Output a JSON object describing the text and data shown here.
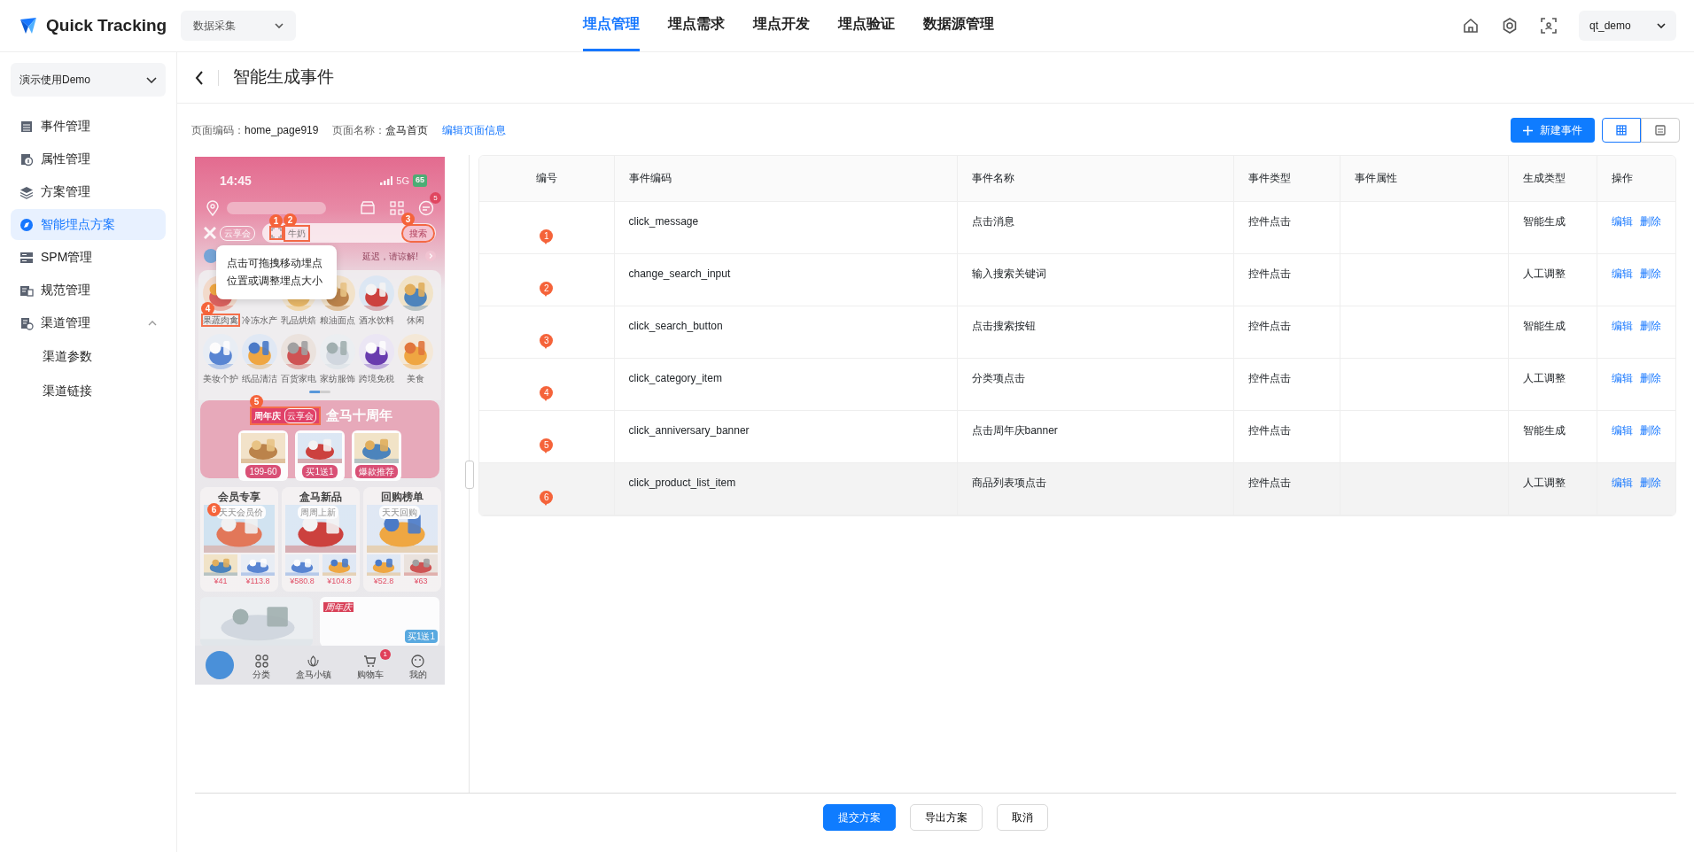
{
  "header": {
    "logo": "Quick Tracking",
    "workspace": "数据采集",
    "user": "qt_demo",
    "nav": [
      {
        "label": "埋点管理",
        "selected": true
      },
      {
        "label": "埋点需求",
        "selected": false
      },
      {
        "label": "埋点开发",
        "selected": false
      },
      {
        "label": "埋点验证",
        "selected": false
      },
      {
        "label": "数据源管理",
        "selected": false
      }
    ]
  },
  "sidebar": {
    "project": "演示使用Demo",
    "items": [
      {
        "label": "事件管理",
        "selected": false
      },
      {
        "label": "属性管理",
        "selected": false
      },
      {
        "label": "方案管理",
        "selected": false
      },
      {
        "label": "智能埋点方案",
        "selected": true
      },
      {
        "label": "SPM管理",
        "selected": false
      },
      {
        "label": "规范管理",
        "selected": false
      },
      {
        "label": "渠道管理",
        "selected": false,
        "expanded": true,
        "children": [
          {
            "label": "渠道参数",
            "selected": false
          },
          {
            "label": "渠道链接",
            "selected": false
          }
        ]
      }
    ]
  },
  "page": {
    "title": "智能生成事件",
    "info": [
      {
        "label": "页面编码：",
        "value": "home_page919"
      },
      {
        "label": "页面名称：",
        "value": "盒马首页"
      }
    ],
    "edit_link": "编辑页面信息",
    "new_button": "新建事件",
    "view_modes": [
      {
        "kind": "table",
        "selected": true
      },
      {
        "kind": "cards",
        "selected": false
      }
    ]
  },
  "preview": {
    "time": "14:45",
    "network": "5G",
    "battery": "65",
    "message_badge": "5",
    "brand": "云享会",
    "search_value": "牛奶",
    "search_button": "搜索",
    "notice": "延迟，请谅解!",
    "tooltip": "点击可拖拽移动埋点位置或调整埋点大小",
    "markers": [
      "1",
      "2",
      "3",
      "4",
      "5",
      "6"
    ],
    "categories": [
      "果蔬肉禽",
      "冷冻水产",
      "乳品烘焙",
      "粮油面点",
      "酒水饮料",
      "休闲",
      "美妆个护",
      "纸品清洁",
      "百货家电",
      "家纺服饰",
      "跨境免税",
      "美食"
    ],
    "banner": {
      "tag": "周年庆",
      "tag_brand": "云享会",
      "title": "盒马十周年",
      "cards": [
        "199-60",
        "买1送1",
        "爆款推荐"
      ]
    },
    "sections": [
      {
        "title": "会员专享",
        "tag": "天天会员价",
        "prices": [
          "¥41",
          "¥113.8"
        ]
      },
      {
        "title": "盒马新品",
        "tag": "周周上新",
        "prices": [
          "¥580.8",
          "¥104.8"
        ]
      },
      {
        "title": "回购榜单",
        "tag": "天天回购",
        "prices": [
          "¥52.8",
          "¥63"
        ]
      }
    ],
    "promo_tag": "周年庆",
    "promo_badge": "买1送1",
    "tabs": [
      {
        "label": "分类"
      },
      {
        "label": "盒马小镇"
      },
      {
        "label": "购物车",
        "badge": "1"
      },
      {
        "label": "我的"
      }
    ]
  },
  "table": {
    "columns": [
      "编号",
      "事件编码",
      "事件名称",
      "事件类型",
      "事件属性",
      "生成类型",
      "操作"
    ],
    "rows": [
      {
        "number": "1",
        "code": "click_message",
        "name": "点击消息",
        "type": "控件点击",
        "origin": "智能生成",
        "actions": [
          "编辑",
          "删除"
        ],
        "selected": false
      },
      {
        "number": "2",
        "code": "change_search_input",
        "name": "输入搜索关键词",
        "type": "控件点击",
        "origin": "人工调整",
        "actions": [
          "编辑",
          "删除"
        ],
        "selected": false
      },
      {
        "number": "3",
        "code": "click_search_button",
        "name": "点击搜索按钮",
        "type": "控件点击",
        "origin": "智能生成",
        "actions": [
          "编辑",
          "删除"
        ],
        "selected": false
      },
      {
        "number": "4",
        "code": "click_category_item",
        "name": "分类项点击",
        "type": "控件点击",
        "origin": "人工调整",
        "actions": [
          "编辑",
          "删除"
        ],
        "selected": false
      },
      {
        "number": "5",
        "code": "click_anniversary_banner",
        "name": "点击周年庆banner",
        "type": "控件点击",
        "origin": "智能生成",
        "actions": [
          "编辑",
          "删除"
        ],
        "selected": false
      },
      {
        "number": "6",
        "code": "click_product_list_item",
        "name": "商品列表项点击",
        "type": "控件点击",
        "origin": "人工调整",
        "actions": [
          "编辑",
          "删除"
        ],
        "selected": true
      }
    ]
  },
  "footer": {
    "buttons": [
      {
        "label": "提交方案",
        "kind": "primary"
      },
      {
        "label": "导出方案",
        "kind": "default"
      },
      {
        "label": "取消",
        "kind": "default"
      }
    ]
  }
}
